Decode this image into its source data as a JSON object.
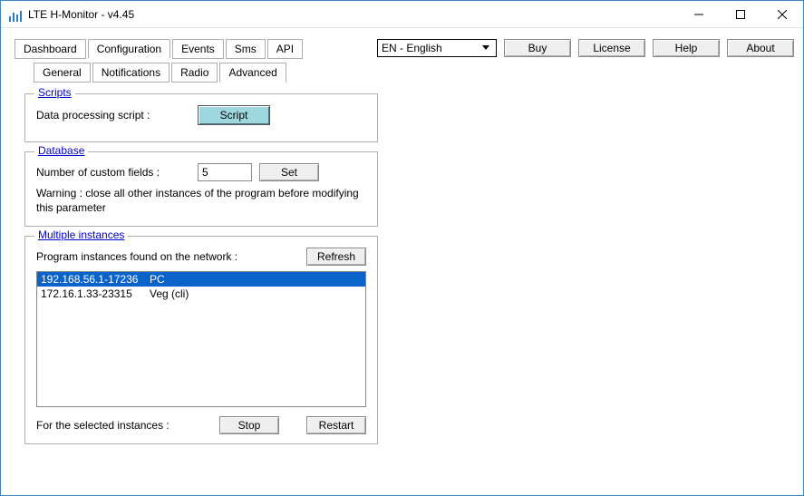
{
  "window": {
    "title": "LTE H-Monitor - v4.45"
  },
  "toolbar": {
    "tabs": {
      "dashboard": "Dashboard",
      "configuration": "Configuration",
      "events": "Events",
      "sms": "Sms",
      "api": "API"
    },
    "language": {
      "selected": "EN - English"
    },
    "buttons": {
      "buy": "Buy",
      "license": "License",
      "help": "Help",
      "about": "About"
    }
  },
  "subtabs": {
    "general": "General",
    "notifications": "Notifications",
    "radio": "Radio",
    "advanced": "Advanced"
  },
  "scripts": {
    "legend": "Scripts",
    "label": "Data processing script :",
    "button": "Script"
  },
  "database": {
    "legend": "Database",
    "label": "Number of custom fields :",
    "value": "5",
    "set": "Set",
    "warning": "Warning : close all other instances of the program before modifying this parameter"
  },
  "multi": {
    "legend": "Multiple instances",
    "found": "Program instances found on the network :",
    "refresh": "Refresh",
    "rows": [
      {
        "addr": "192.168.56.1-17236",
        "name": "PC",
        "selected": true
      },
      {
        "addr": "172.16.1.33-23315",
        "name": "Veg (cli)",
        "selected": false
      }
    ],
    "for_selected": "For the selected instances :",
    "stop": "Stop",
    "restart": "Restart"
  }
}
